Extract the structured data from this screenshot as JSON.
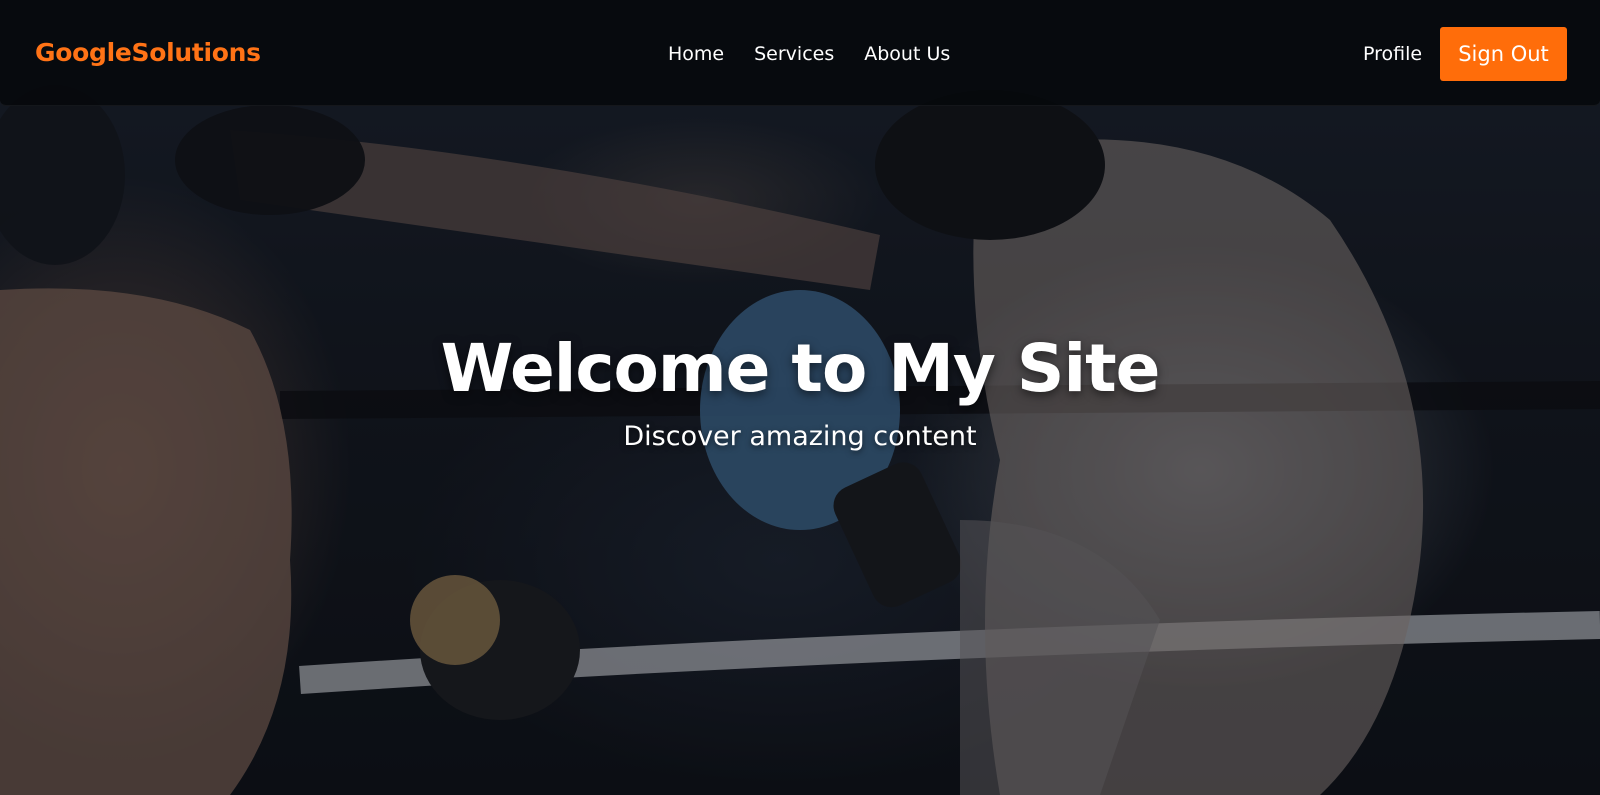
{
  "nav": {
    "brand": "GoogleSolutions",
    "links": [
      "Home",
      "Services",
      "About Us"
    ],
    "profile": "Profile",
    "signout": "Sign Out"
  },
  "hero": {
    "title": "Welcome to My Site",
    "subtitle": "Discover amazing content",
    "background_image": "boxing-sparring-photo"
  },
  "colors": {
    "accent": "#ff6d0a",
    "brand_text": "#ff7316",
    "navbar_bg": "#06080b",
    "text": "#ffffff"
  }
}
